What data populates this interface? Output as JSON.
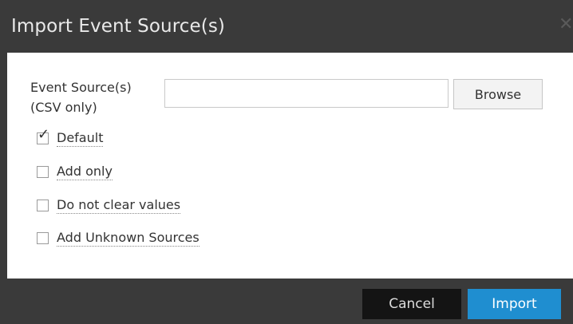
{
  "dialog": {
    "title": "Import Event Source(s)",
    "close_icon": "close-icon"
  },
  "form": {
    "field_label_line1": "Event Source(s)",
    "field_label_line2": "(CSV only)",
    "file_input_value": "",
    "browse_label": "Browse"
  },
  "options": [
    {
      "label": "Default",
      "checked": true
    },
    {
      "label": "Add only",
      "checked": false
    },
    {
      "label": "Do not clear values",
      "checked": false
    },
    {
      "label": "Add Unknown Sources",
      "checked": false
    }
  ],
  "footer": {
    "cancel_label": "Cancel",
    "import_label": "Import"
  },
  "colors": {
    "titlebar": "#3a3a3a",
    "primary_button": "#1f8ed0",
    "cancel_button": "#141414"
  }
}
